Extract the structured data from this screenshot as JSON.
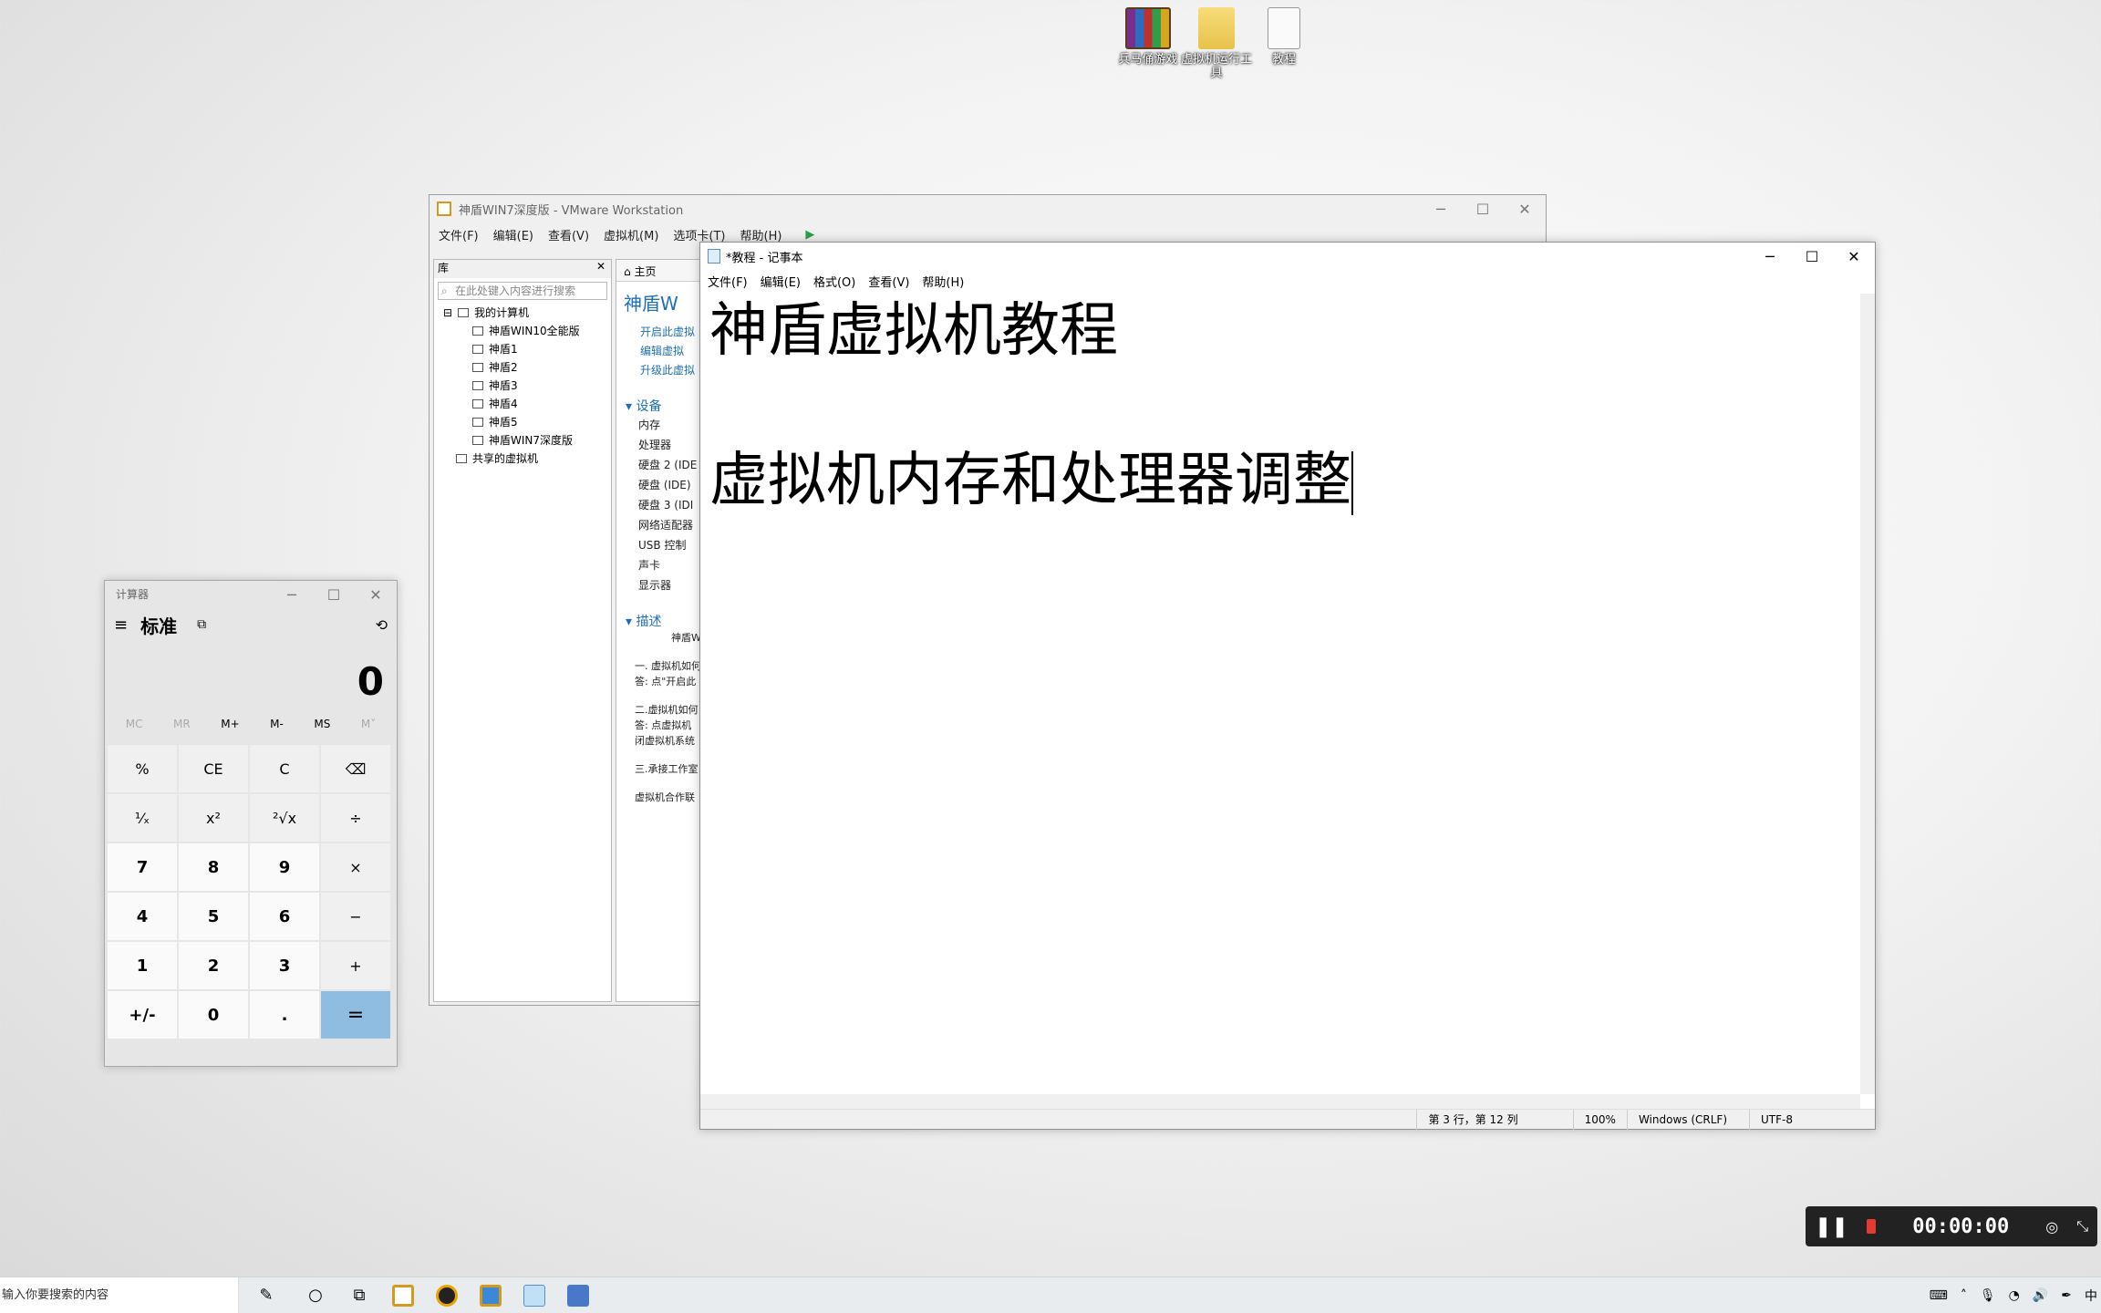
{
  "desktop": {
    "icons": [
      {
        "label": "兵马俑游戏",
        "icon": "rar-archive-icon"
      },
      {
        "label": "虚拟机运行工具",
        "icon": "folder-icon"
      },
      {
        "label": "教程",
        "icon": "text-file-icon"
      }
    ]
  },
  "vmware": {
    "title": "神盾WIN7深度版 - VMware Workstation",
    "menu": [
      "文件(F)",
      "编辑(E)",
      "查看(V)",
      "虚拟机(M)",
      "选项卡(T)",
      "帮助(H)"
    ],
    "library": {
      "header": "库",
      "search_placeholder": "在此处键入内容进行搜索",
      "root": "我的计算机",
      "vms": [
        "神盾WIN10全能版",
        "神盾1",
        "神盾2",
        "神盾3",
        "神盾4",
        "神盾5",
        "神盾WIN7深度版"
      ],
      "shared": "共享的虚拟机"
    },
    "tab_home": "主页",
    "vm_name": "神盾W",
    "actions": [
      "开启此虚拟",
      "编辑虚拟",
      "升级此虚拟"
    ],
    "devices_header": "设备",
    "devices": [
      "内存",
      "处理器",
      "硬盘 2 (IDE",
      "硬盘 (IDE)",
      "硬盘 3 (IDI",
      "网络适配器",
      "USB 控制",
      "声卡",
      "显示器"
    ],
    "description_header": "描述",
    "description": [
      "神盾W",
      "一. 虚拟机如何",
      "答: 点\"开启此",
      "二.虚拟机如何",
      "答: 点虚拟机",
      "闭虚拟机系统",
      "三.承接工作室",
      "虚拟机合作联"
    ]
  },
  "notepad": {
    "title": "*教程 - 记事本",
    "menu": [
      "文件(F)",
      "编辑(E)",
      "格式(O)",
      "查看(V)",
      "帮助(H)"
    ],
    "lines": [
      "神盾虚拟机教程",
      "",
      "虚拟机内存和处理器调整"
    ],
    "status": {
      "position": "第 3 行，第 12 列",
      "zoom": "100%",
      "eol": "Windows (CRLF)",
      "encoding": "UTF-8"
    }
  },
  "calculator": {
    "title": "计算器",
    "mode": "标准",
    "display": "0",
    "memory": [
      "MC",
      "MR",
      "M+",
      "M-",
      "MS",
      "M˅"
    ],
    "keys": [
      "%",
      "CE",
      "C",
      "⌫",
      "¹⁄ₓ",
      "x²",
      "²√x",
      "÷",
      "7",
      "8",
      "9",
      "×",
      "4",
      "5",
      "6",
      "−",
      "1",
      "2",
      "3",
      "+",
      "+/-",
      "0",
      ".",
      "="
    ]
  },
  "recorder": {
    "time": "00:00:00"
  },
  "taskbar": {
    "search_placeholder": "输入你要搜索的内容",
    "ime": "中"
  }
}
